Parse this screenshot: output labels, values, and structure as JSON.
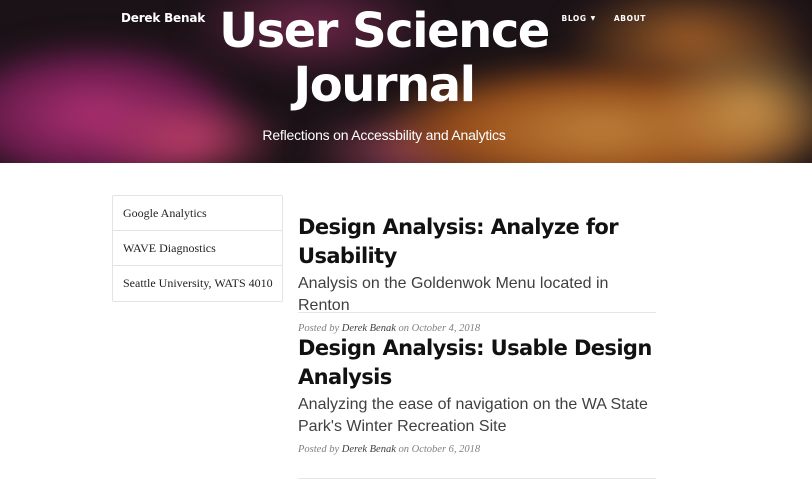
{
  "header": {
    "brand": "Derek Benak",
    "nav": [
      {
        "label": "BLOG",
        "has_dropdown": true
      },
      {
        "label": "ABOUT",
        "has_dropdown": false
      }
    ],
    "title_line1": "User Science",
    "title_line2": "Journal",
    "subtitle": "Reflections on Accessbility and Analytics"
  },
  "sidebar": {
    "items": [
      {
        "label": "Google Analytics"
      },
      {
        "label": "WAVE Diagnostics"
      },
      {
        "label": "Seattle University, WATS 4010"
      }
    ]
  },
  "posts": [
    {
      "title": "Design Analysis: Analyze for Usability",
      "subtitle": "Analysis on the Goldenwok Menu located in Renton",
      "posted_by_prefix": "Posted by",
      "author": "Derek Benak",
      "on_word": "on",
      "date": "October 4, 2018"
    },
    {
      "title": "Design Analysis: Usable Design Analysis",
      "subtitle": "Analyzing the ease of navigation on the WA State Park's Winter Recreation Site",
      "posted_by_prefix": "Posted by",
      "author": "Derek Benak",
      "on_word": "on",
      "date": "October 6, 2018"
    }
  ],
  "icons": {
    "blog_dropdown": "caret-down-icon"
  },
  "colors": {
    "text_dark": "#111111",
    "text_sub": "#404040",
    "meta": "#808080",
    "border": "#e3e3e3"
  }
}
